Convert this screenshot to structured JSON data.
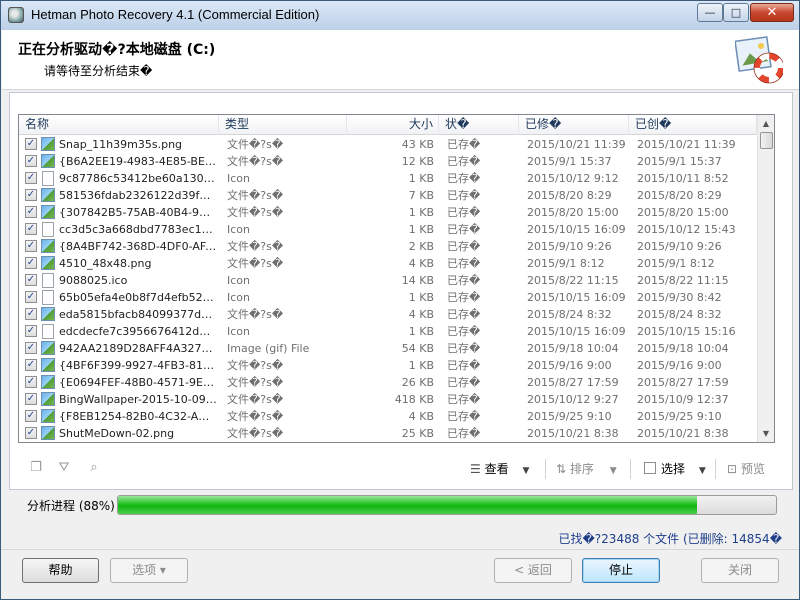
{
  "window": {
    "title": "Hetman Photo Recovery 4.1 (Commercial Edition)",
    "controls": {
      "minimize": "—",
      "maximize": "□",
      "close": "✕"
    }
  },
  "header": {
    "title": "正在分析驱动�?本地磁盘 (C:)",
    "subtitle": "请等待至分析结束�"
  },
  "table": {
    "columns": [
      "名称",
      "类型",
      "大小",
      "状�",
      "已修�",
      "已创�"
    ],
    "rows": [
      {
        "checked": true,
        "icon": "image-file-icon",
        "name": "Snap_11h39m35s.png",
        "type": "文件�?s�",
        "size": "43 KB",
        "status": "已存�",
        "modified": "2015/10/21 11:39",
        "created": "2015/10/21 11:39"
      },
      {
        "checked": true,
        "icon": "image-file-icon",
        "name": "{B6A2EE19-4983-4E85-BEFD-…",
        "type": "文件�?s�",
        "size": "12 KB",
        "status": "已存�",
        "modified": "2015/9/1 15:37",
        "created": "2015/9/1 15:37"
      },
      {
        "checked": true,
        "icon": "document-file-icon",
        "name": "9c87786c53412be60a130fbb7…",
        "type": "Icon",
        "size": "1 KB",
        "status": "已存�",
        "modified": "2015/10/12 9:12",
        "created": "2015/10/11 8:52"
      },
      {
        "checked": true,
        "icon": "image-file-icon",
        "name": "581536fdab2326122d39fb77b…",
        "type": "文件�?s�",
        "size": "7 KB",
        "status": "已存�",
        "modified": "2015/8/20 8:29",
        "created": "2015/8/20 8:29"
      },
      {
        "checked": true,
        "icon": "image-file-icon",
        "name": "{307842B5-75AB-40B4-9A22-…",
        "type": "文件�?s�",
        "size": "1 KB",
        "status": "已存�",
        "modified": "2015/8/20 15:00",
        "created": "2015/8/20 15:00"
      },
      {
        "checked": true,
        "icon": "document-file-icon",
        "name": "cc3d5c3a668dbd7783ec13212…",
        "type": "Icon",
        "size": "1 KB",
        "status": "已存�",
        "modified": "2015/10/15 16:09",
        "created": "2015/10/12 15:43"
      },
      {
        "checked": true,
        "icon": "image-file-icon",
        "name": "{8A4BF742-368D-4DF0-AFAF-…",
        "type": "文件�?s�",
        "size": "2 KB",
        "status": "已存�",
        "modified": "2015/9/10 9:26",
        "created": "2015/9/10 9:26"
      },
      {
        "checked": true,
        "icon": "image-file-icon",
        "name": "4510_48x48.png",
        "type": "文件�?s�",
        "size": "4 KB",
        "status": "已存�",
        "modified": "2015/9/1 8:12",
        "created": "2015/9/1 8:12"
      },
      {
        "checked": true,
        "icon": "document-file-icon",
        "name": "9088025.ico",
        "type": "Icon",
        "size": "14 KB",
        "status": "已存�",
        "modified": "2015/8/22 11:15",
        "created": "2015/8/22 11:15"
      },
      {
        "checked": true,
        "icon": "document-file-icon",
        "name": "65b05efa4e0b8f7d4efb52a1.ico",
        "type": "Icon",
        "size": "1 KB",
        "status": "已存�",
        "modified": "2015/10/15 16:09",
        "created": "2015/9/30 8:42"
      },
      {
        "checked": true,
        "icon": "image-file-icon",
        "name": "eda5815bfacb84099377d5554…",
        "type": "文件�?s�",
        "size": "4 KB",
        "status": "已存�",
        "modified": "2015/8/24 8:32",
        "created": "2015/8/24 8:32"
      },
      {
        "checked": true,
        "icon": "document-file-icon",
        "name": "edcdecfe7c3956676412d20bd…",
        "type": "Icon",
        "size": "1 KB",
        "status": "已存�",
        "modified": "2015/10/15 16:09",
        "created": "2015/10/15 15:16"
      },
      {
        "checked": true,
        "icon": "image-file-icon",
        "name": "942AA2189D28AFF4A327175…",
        "type": "Image (gif) File",
        "size": "54 KB",
        "status": "已存�",
        "modified": "2015/9/18 10:04",
        "created": "2015/9/18 10:04"
      },
      {
        "checked": true,
        "icon": "image-file-icon",
        "name": "{4BF6F399-9927-4FB3-81D0-7…",
        "type": "文件�?s�",
        "size": "1 KB",
        "status": "已存�",
        "modified": "2015/9/16 9:00",
        "created": "2015/9/16 9:00"
      },
      {
        "checked": true,
        "icon": "image-file-icon",
        "name": "{E0694FEF-48B0-4571-9E25-E…",
        "type": "文件�?s�",
        "size": "26 KB",
        "status": "已存�",
        "modified": "2015/8/27 17:59",
        "created": "2015/8/27 17:59"
      },
      {
        "checked": true,
        "icon": "image-file-icon",
        "name": "BingWallpaper-2015-10-09.jpg",
        "type": "文件�?s�",
        "size": "418 KB",
        "status": "已存�",
        "modified": "2015/10/12 9:27",
        "created": "2015/10/9 12:37"
      },
      {
        "checked": true,
        "icon": "image-file-icon",
        "name": "{F8EB1254-82B0-4C32-AD47-…",
        "type": "文件�?s�",
        "size": "4 KB",
        "status": "已存�",
        "modified": "2015/9/25 9:10",
        "created": "2015/9/25 9:10"
      },
      {
        "checked": true,
        "icon": "image-file-icon",
        "name": "ShutMeDown-02.png",
        "type": "文件�?s�",
        "size": "25 KB",
        "status": "已存�",
        "modified": "2015/10/21 8:38",
        "created": "2015/10/21 8:38"
      }
    ]
  },
  "toolbar": {
    "view_label": "查看",
    "sort_label": "排序",
    "select_label": "选择",
    "preview_label": "预览"
  },
  "progress": {
    "label": "分析进程 (88%)",
    "percent": 88
  },
  "status": {
    "found_text": "已找�?23488 个文件 (已删除: 14854�"
  },
  "buttons": {
    "help": "帮助",
    "options": "选项 ▾",
    "back": "< 返回",
    "stop": "停止",
    "close": "关闭"
  }
}
